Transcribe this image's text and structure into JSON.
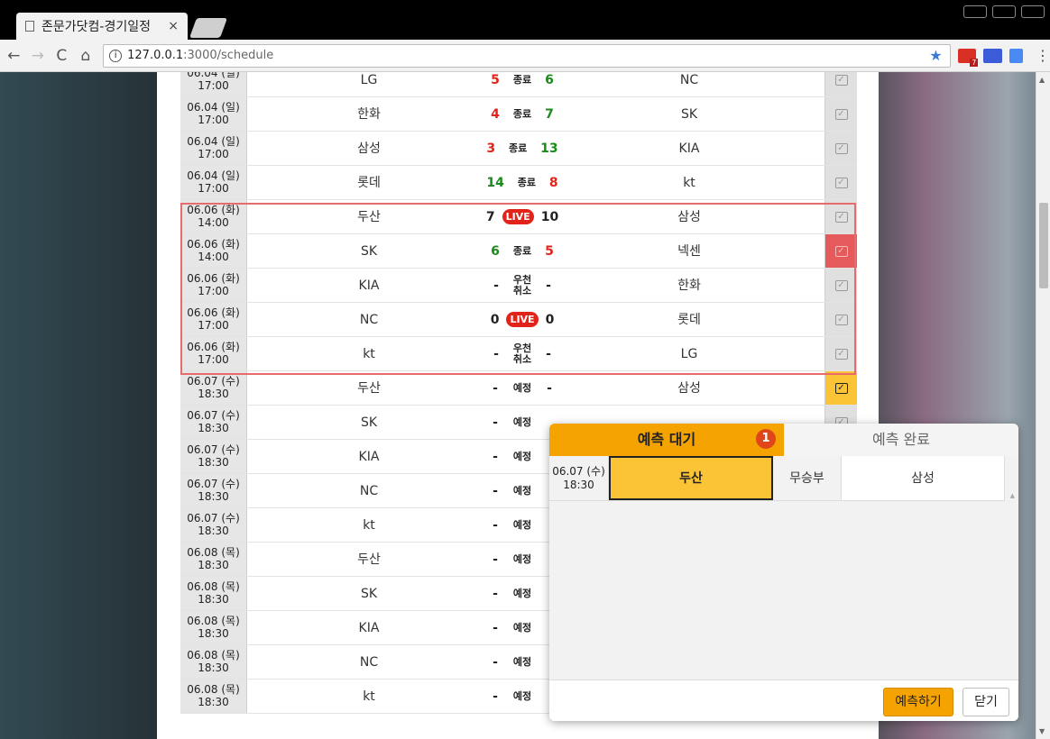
{
  "browser": {
    "tab_title": "존문가닷컴-경기일정",
    "tab_close": "×",
    "url_host": "127.0.0.1",
    "url_path": ":3000/schedule",
    "ext_badge": "7"
  },
  "schedule": [
    {
      "date": "06.04 (일)",
      "time": "17:00",
      "team1": "LG",
      "s1": "5",
      "s1c": "red",
      "status": "종료",
      "live": false,
      "s2": "6",
      "s2c": "green",
      "team2": "NC",
      "check": "grey"
    },
    {
      "date": "06.04 (일)",
      "time": "17:00",
      "team1": "한화",
      "s1": "4",
      "s1c": "red",
      "status": "종료",
      "live": false,
      "s2": "7",
      "s2c": "green",
      "team2": "SK",
      "check": "grey"
    },
    {
      "date": "06.04 (일)",
      "time": "17:00",
      "team1": "삼성",
      "s1": "3",
      "s1c": "red",
      "status": "종료",
      "live": false,
      "s2": "13",
      "s2c": "green",
      "team2": "KIA",
      "check": "grey"
    },
    {
      "date": "06.04 (일)",
      "time": "17:00",
      "team1": "롯데",
      "s1": "14",
      "s1c": "green",
      "status": "종료",
      "live": false,
      "s2": "8",
      "s2c": "red",
      "team2": "kt",
      "check": "grey"
    },
    {
      "date": "06.06 (화)",
      "time": "14:00",
      "team1": "두산",
      "s1": "7",
      "s1c": "black",
      "status": "LIVE",
      "live": true,
      "s2": "10",
      "s2c": "black",
      "team2": "삼성",
      "check": "grey"
    },
    {
      "date": "06.06 (화)",
      "time": "14:00",
      "team1": "SK",
      "s1": "6",
      "s1c": "green",
      "status": "종료",
      "live": false,
      "s2": "5",
      "s2c": "red",
      "team2": "넥센",
      "check": "red"
    },
    {
      "date": "06.06 (화)",
      "time": "17:00",
      "team1": "KIA",
      "s1": "-",
      "s1c": "black",
      "status": "우천 취소",
      "live": false,
      "s2": "-",
      "s2c": "black",
      "team2": "한화",
      "check": "grey"
    },
    {
      "date": "06.06 (화)",
      "time": "17:00",
      "team1": "NC",
      "s1": "0",
      "s1c": "black",
      "status": "LIVE",
      "live": true,
      "s2": "0",
      "s2c": "black",
      "team2": "롯데",
      "check": "grey"
    },
    {
      "date": "06.06 (화)",
      "time": "17:00",
      "team1": "kt",
      "s1": "-",
      "s1c": "black",
      "status": "우천 취소",
      "live": false,
      "s2": "-",
      "s2c": "black",
      "team2": "LG",
      "check": "grey"
    },
    {
      "date": "06.07 (수)",
      "time": "18:30",
      "team1": "두산",
      "s1": "-",
      "s1c": "black",
      "status": "예정",
      "live": false,
      "s2": "-",
      "s2c": "black",
      "team2": "삼성",
      "check": "yellow"
    },
    {
      "date": "06.07 (수)",
      "time": "18:30",
      "team1": "SK",
      "s1": "-",
      "s1c": "black",
      "status": "예정",
      "live": false,
      "s2": "",
      "s2c": "black",
      "team2": "",
      "check": "none"
    },
    {
      "date": "06.07 (수)",
      "time": "18:30",
      "team1": "KIA",
      "s1": "-",
      "s1c": "black",
      "status": "예정",
      "live": false,
      "s2": "",
      "s2c": "black",
      "team2": "",
      "check": "none"
    },
    {
      "date": "06.07 (수)",
      "time": "18:30",
      "team1": "NC",
      "s1": "-",
      "s1c": "black",
      "status": "예정",
      "live": false,
      "s2": "",
      "s2c": "black",
      "team2": "",
      "check": "none"
    },
    {
      "date": "06.07 (수)",
      "time": "18:30",
      "team1": "kt",
      "s1": "-",
      "s1c": "black",
      "status": "예정",
      "live": false,
      "s2": "",
      "s2c": "black",
      "team2": "",
      "check": "none"
    },
    {
      "date": "06.08 (목)",
      "time": "18:30",
      "team1": "두산",
      "s1": "-",
      "s1c": "black",
      "status": "예정",
      "live": false,
      "s2": "",
      "s2c": "black",
      "team2": "",
      "check": "none"
    },
    {
      "date": "06.08 (목)",
      "time": "18:30",
      "team1": "SK",
      "s1": "-",
      "s1c": "black",
      "status": "예정",
      "live": false,
      "s2": "",
      "s2c": "black",
      "team2": "",
      "check": "none"
    },
    {
      "date": "06.08 (목)",
      "time": "18:30",
      "team1": "KIA",
      "s1": "-",
      "s1c": "black",
      "status": "예정",
      "live": false,
      "s2": "",
      "s2c": "black",
      "team2": "",
      "check": "none"
    },
    {
      "date": "06.08 (목)",
      "time": "18:30",
      "team1": "NC",
      "s1": "-",
      "s1c": "black",
      "status": "예정",
      "live": false,
      "s2": "",
      "s2c": "black",
      "team2": "",
      "check": "none"
    },
    {
      "date": "06.08 (목)",
      "time": "18:30",
      "team1": "kt",
      "s1": "-",
      "s1c": "black",
      "status": "예정",
      "live": false,
      "s2": "",
      "s2c": "black",
      "team2": "",
      "check": "none"
    }
  ],
  "modal": {
    "tab_pending": "예측 대기",
    "tab_pending_count": "1",
    "tab_done": "예측 완료",
    "game": {
      "date": "06.07 (수)",
      "time": "18:30",
      "team1": "두산",
      "draw": "무승부",
      "team2": "삼성"
    },
    "predict_button": "예측하기",
    "close_button": "닫기"
  },
  "colors": {
    "accent": "#f4a300",
    "live": "#e2231a",
    "win_green": "#1a8a1a",
    "highlight_border": "#e86a6a"
  }
}
